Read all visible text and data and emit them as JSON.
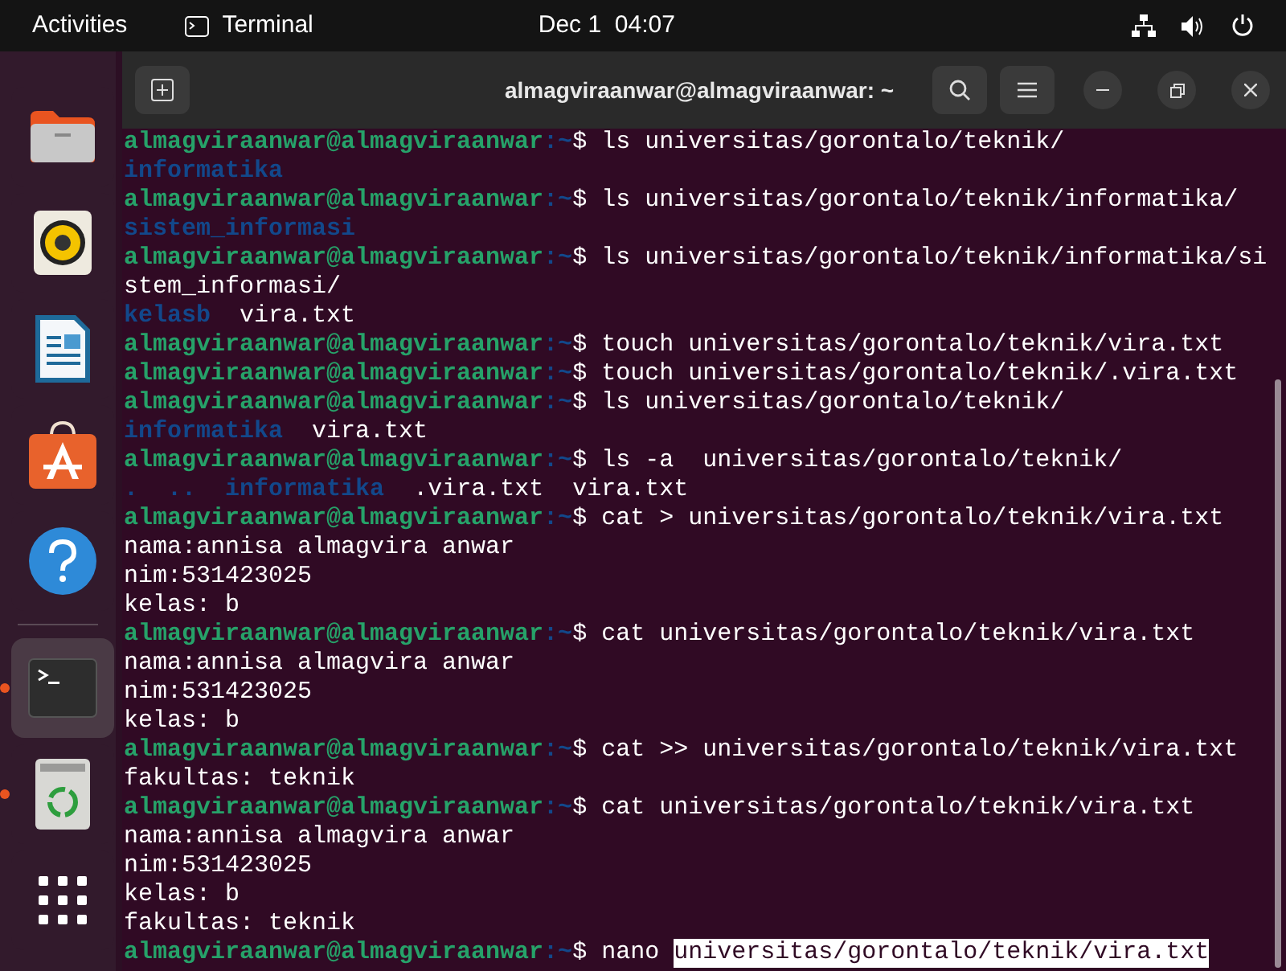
{
  "top_bar": {
    "activities": "Activities",
    "app": "Terminal",
    "clock": "Dec 1  04:07"
  },
  "dock": {
    "items": [
      {
        "kind": "files",
        "running": false,
        "selected": false
      },
      {
        "kind": "music",
        "running": false,
        "selected": false
      },
      {
        "kind": "writer",
        "running": false,
        "selected": false
      },
      {
        "kind": "store",
        "running": false,
        "selected": false
      },
      {
        "kind": "help",
        "running": false,
        "selected": false
      },
      {
        "kind": "separator"
      },
      {
        "kind": "terminal",
        "running": true,
        "selected": true
      },
      {
        "kind": "trash",
        "running": true,
        "selected": false
      },
      {
        "kind": "apps",
        "running": false,
        "selected": false
      }
    ]
  },
  "window": {
    "title": "almagviraanwar@almagviraanwar: ~"
  },
  "terminal": {
    "lines": [
      {
        "kind": "prompt",
        "user": "almagviraanwar@almagviraanwar",
        "path": ":~",
        "symbol": "$",
        "command": "ls universitas/gorontalo/teknik/"
      },
      {
        "kind": "output",
        "items": [
          {
            "kind": "dir",
            "text": "informatika"
          }
        ]
      },
      {
        "kind": "prompt",
        "user": "almagviraanwar@almagviraanwar",
        "path": ":~",
        "symbol": "$",
        "command": "ls universitas/gorontalo/teknik/informatika/"
      },
      {
        "kind": "output",
        "items": [
          {
            "kind": "dir",
            "text": "sistem_informasi"
          }
        ]
      },
      {
        "kind": "prompt",
        "user": "almagviraanwar@almagviraanwar",
        "path": ":~",
        "symbol": "$",
        "command": "ls universitas/gorontalo/teknik/informatika/si"
      },
      {
        "kind": "output",
        "items": [
          {
            "kind": "file",
            "text": "stem_informasi/"
          }
        ]
      },
      {
        "kind": "output",
        "items": [
          {
            "kind": "dir",
            "text": "kelasb"
          },
          {
            "kind": "file",
            "text": "vira.txt"
          }
        ]
      },
      {
        "kind": "prompt",
        "user": "almagviraanwar@almagviraanwar",
        "path": ":~",
        "symbol": "$",
        "command": "touch universitas/gorontalo/teknik/vira.txt"
      },
      {
        "kind": "prompt",
        "user": "almagviraanwar@almagviraanwar",
        "path": ":~",
        "symbol": "$",
        "command": "touch universitas/gorontalo/teknik/.vira.txt"
      },
      {
        "kind": "prompt",
        "user": "almagviraanwar@almagviraanwar",
        "path": ":~",
        "symbol": "$",
        "command": "ls universitas/gorontalo/teknik/"
      },
      {
        "kind": "output",
        "items": [
          {
            "kind": "dir",
            "text": "informatika"
          },
          {
            "kind": "file",
            "text": "vira.txt"
          }
        ]
      },
      {
        "kind": "prompt",
        "user": "almagviraanwar@almagviraanwar",
        "path": ":~",
        "symbol": "$",
        "command": "ls -a  universitas/gorontalo/teknik/"
      },
      {
        "kind": "output",
        "items": [
          {
            "kind": "dir",
            "text": "."
          },
          {
            "kind": "dir",
            "text": ".."
          },
          {
            "kind": "dir",
            "text": "informatika"
          },
          {
            "kind": "file",
            "text": ".vira.txt"
          },
          {
            "kind": "file",
            "text": "vira.txt"
          }
        ]
      },
      {
        "kind": "prompt",
        "user": "almagviraanwar@almagviraanwar",
        "path": ":~",
        "symbol": "$",
        "command": "cat > universitas/gorontalo/teknik/vira.txt"
      },
      {
        "kind": "output",
        "items": [
          {
            "kind": "file",
            "text": "nama:annisa almagvira anwar"
          }
        ]
      },
      {
        "kind": "output",
        "items": [
          {
            "kind": "file",
            "text": "nim:531423025"
          }
        ]
      },
      {
        "kind": "output",
        "items": [
          {
            "kind": "file",
            "text": "kelas: b"
          }
        ]
      },
      {
        "kind": "prompt",
        "user": "almagviraanwar@almagviraanwar",
        "path": ":~",
        "symbol": "$",
        "command": "cat universitas/gorontalo/teknik/vira.txt"
      },
      {
        "kind": "output",
        "items": [
          {
            "kind": "file",
            "text": "nama:annisa almagvira anwar"
          }
        ]
      },
      {
        "kind": "output",
        "items": [
          {
            "kind": "file",
            "text": "nim:531423025"
          }
        ]
      },
      {
        "kind": "output",
        "items": [
          {
            "kind": "file",
            "text": "kelas: b"
          }
        ]
      },
      {
        "kind": "prompt",
        "user": "almagviraanwar@almagviraanwar",
        "path": ":~",
        "symbol": "$",
        "command": "cat >> universitas/gorontalo/teknik/vira.txt"
      },
      {
        "kind": "output",
        "items": [
          {
            "kind": "file",
            "text": "fakultas: teknik"
          }
        ]
      },
      {
        "kind": "prompt",
        "user": "almagviraanwar@almagviraanwar",
        "path": ":~",
        "symbol": "$",
        "command": "cat universitas/gorontalo/teknik/vira.txt"
      },
      {
        "kind": "output",
        "items": [
          {
            "kind": "file",
            "text": "nama:annisa almagvira anwar"
          }
        ]
      },
      {
        "kind": "output",
        "items": [
          {
            "kind": "file",
            "text": "nim:531423025"
          }
        ]
      },
      {
        "kind": "output",
        "items": [
          {
            "kind": "file",
            "text": "kelas: b"
          }
        ]
      },
      {
        "kind": "output",
        "items": [
          {
            "kind": "file",
            "text": "fakultas: teknik"
          }
        ]
      },
      {
        "kind": "prompt",
        "user": "almagviraanwar@almagviraanwar",
        "path": ":~",
        "symbol": "$",
        "command": "nano",
        "selection": "universitas/gorontalo/teknik/vira.txt"
      }
    ]
  }
}
